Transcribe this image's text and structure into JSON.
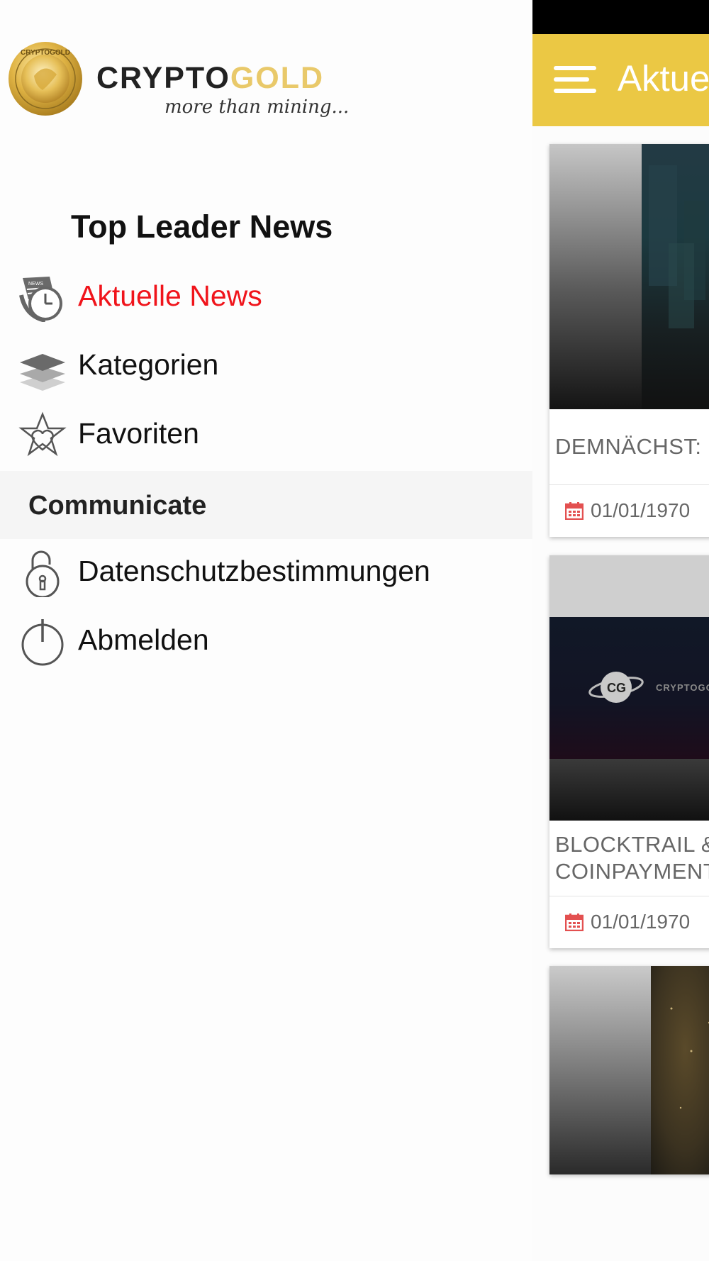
{
  "status_bar": {},
  "app_bar": {
    "title": "Aktuelle News",
    "menu_icon": "hamburger-menu-icon",
    "color": "#ebc844"
  },
  "brand": {
    "name_part1": "CRYPTO",
    "name_part2": "GOLD",
    "tagline": "more than mining...",
    "coin_text": "CRYPTOGOLD",
    "gold_color": "#e9c96a"
  },
  "drawer": {
    "section_title": "Top Leader News",
    "items": [
      {
        "label": "Aktuelle News",
        "icon": "news-clock-icon",
        "active": true
      },
      {
        "label": "Kategorien",
        "icon": "layers-icon",
        "active": false
      },
      {
        "label": "Favoriten",
        "icon": "star-heart-icon",
        "active": false
      }
    ],
    "group_title": "Communicate",
    "group_items": [
      {
        "label": "Datenschutzbestimmungen",
        "icon": "padlock-icon"
      },
      {
        "label": "Abmelden",
        "icon": "power-icon"
      }
    ],
    "active_color": "#f0141b"
  },
  "news": [
    {
      "title_line1": "DEMNÄCHST:",
      "date": "01/01/1970",
      "image": "city-night-thumbnail"
    },
    {
      "title_line1": "BLOCKTRAIL &",
      "title_line2": "COINPAYMENTS",
      "date": "01/01/1970",
      "image": "cgn-logo-thumbnail",
      "image_logo_text": "CRYPTOGOLD"
    },
    {
      "image": "gold-nugget-thumbnail"
    }
  ]
}
